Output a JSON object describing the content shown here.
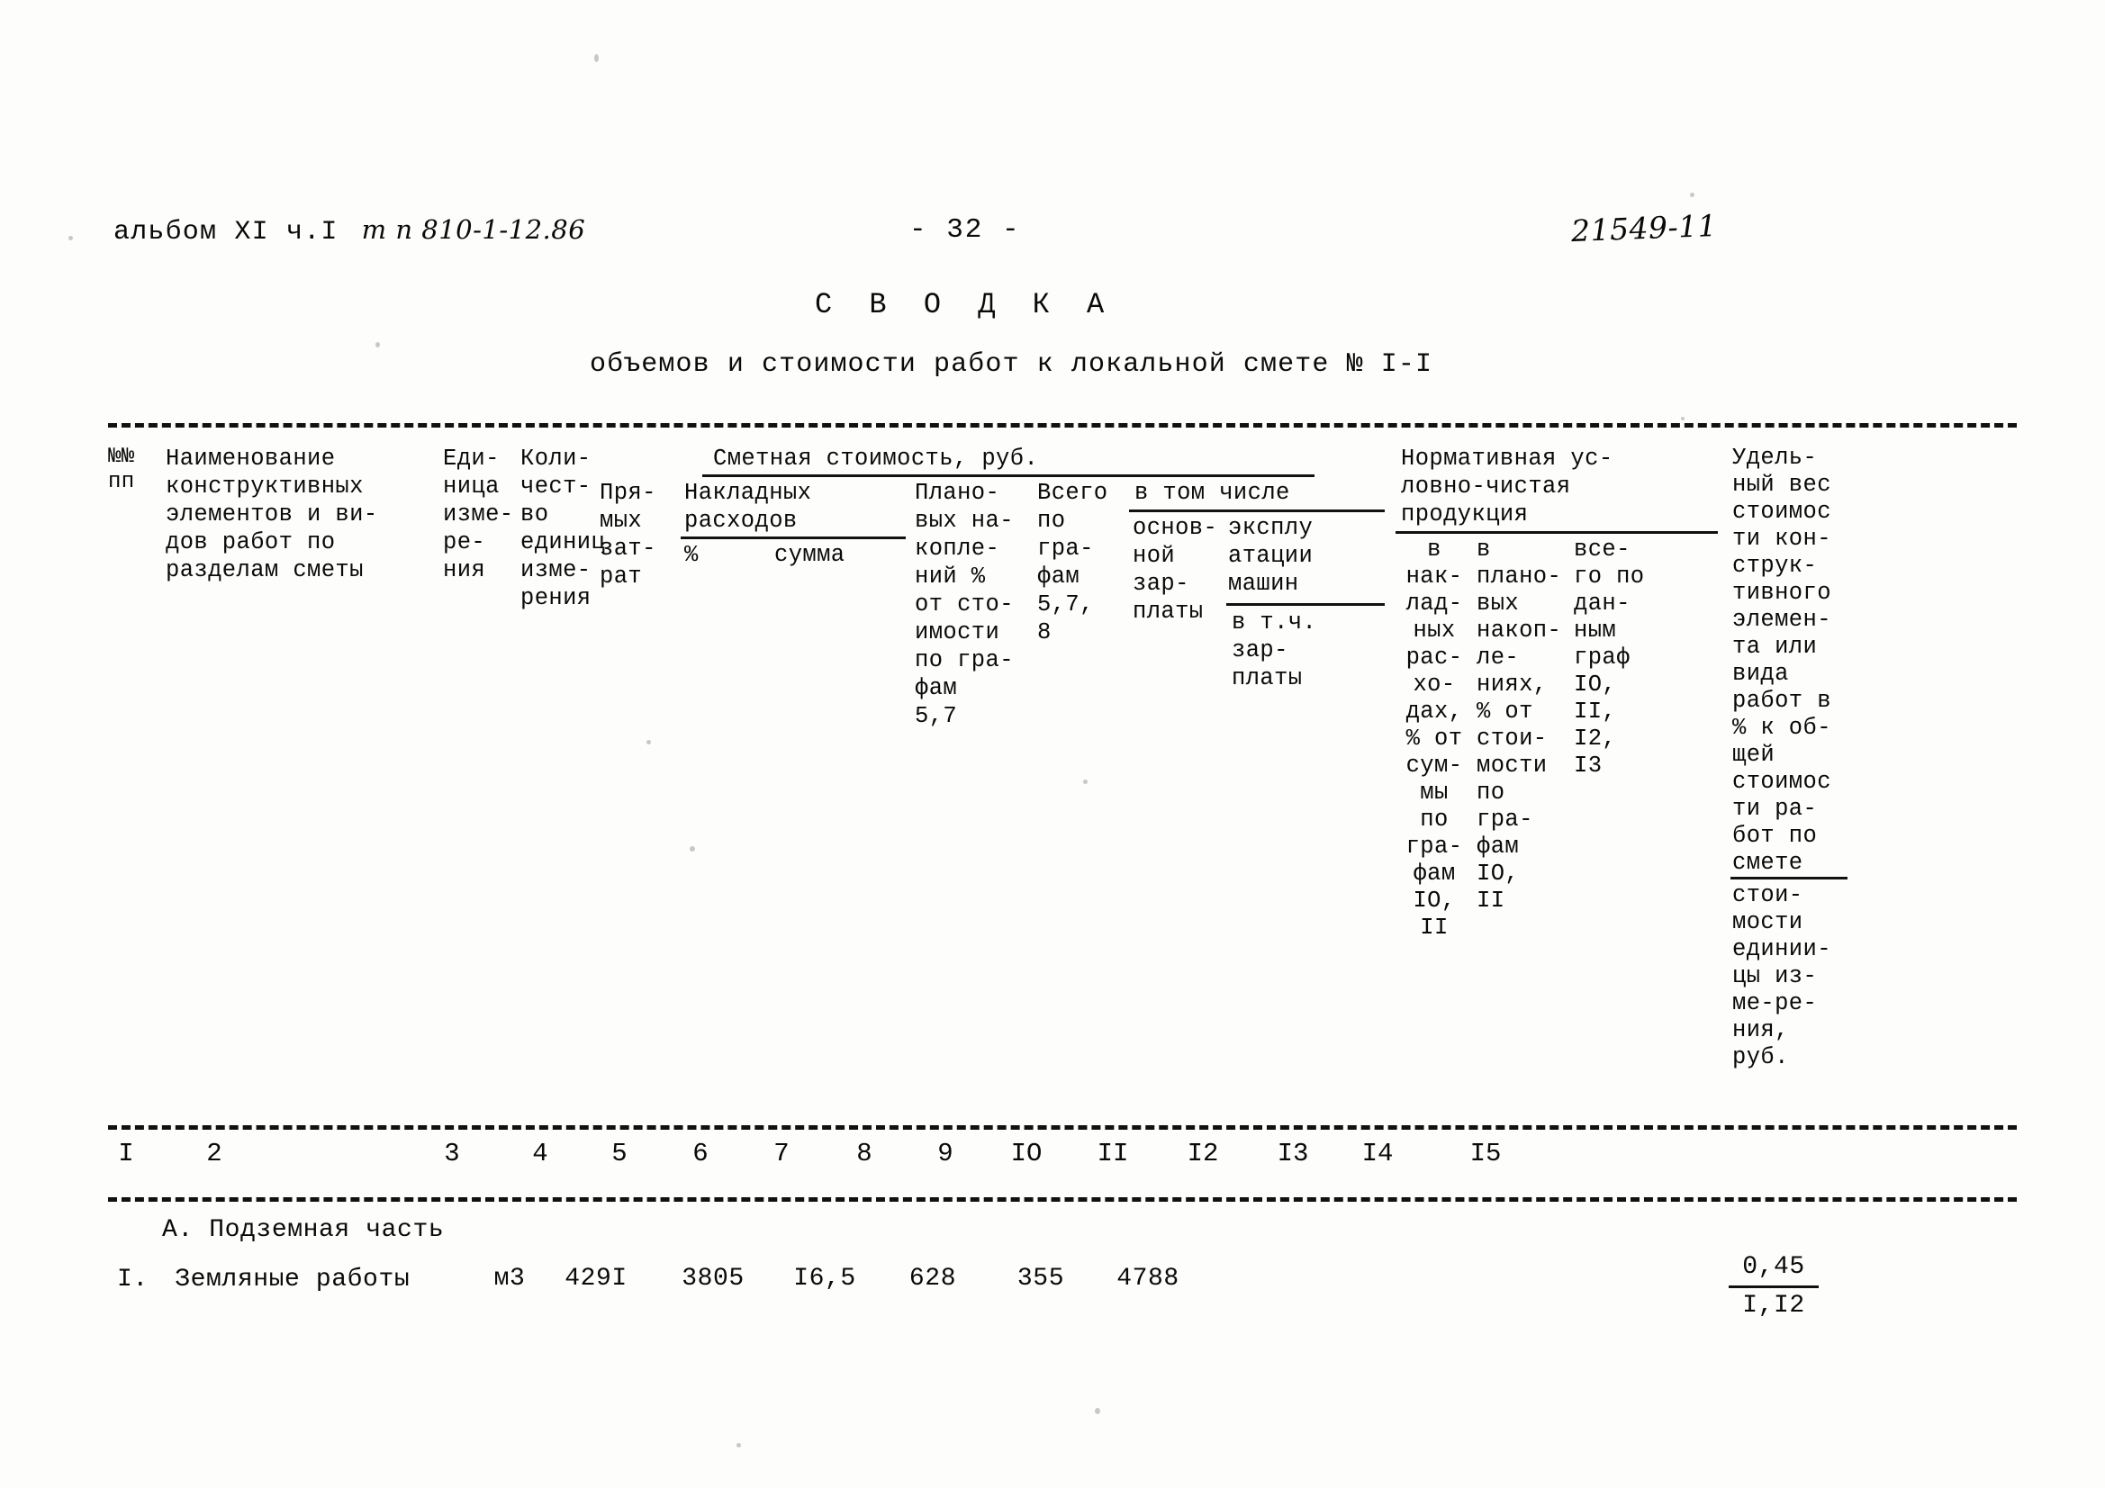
{
  "header": {
    "album": "альбом XI ч.I",
    "type_code": "т п 810-1-12.86",
    "page_number": "- 32 -",
    "doc_code": "21549-11"
  },
  "title": {
    "main": "С В О Д К А",
    "subtitle": "объемов и стоимости работ к локальной смете № I-I"
  },
  "table": {
    "group_headers": [
      {
        "label": "Сметная стоимость, руб."
      },
      {
        "label": "в том числе"
      },
      {
        "label": "Нормативная ус-\nловно-чистая\nпродукция"
      }
    ],
    "columns": [
      {
        "num": "I",
        "title": "№№\nпп"
      },
      {
        "num": "2",
        "title": "Наименование\nконструктивных\nэлементов и ви-\nдов работ по\nразделам сметы"
      },
      {
        "num": "3",
        "title": "Еди-\nница\nизме-\nре-\nния"
      },
      {
        "num": "4",
        "title": "Коли-\nчест-\nво\nединиц\nизме-\nрения"
      },
      {
        "num": "5",
        "title": "Пря-\nмых\nзат-\nрат"
      },
      {
        "num": "6",
        "title": "%"
      },
      {
        "num": "7",
        "title": "сумма"
      },
      {
        "num": "8",
        "title": "Плано-\nвых на-\nкопле-\nний %\nот сто-\nимости\nпо гра-\nфам\n5,7"
      },
      {
        "num": "9",
        "title": "Всего\nпо\nгра-\nфам\n5,7,\n8"
      },
      {
        "num": "IO",
        "title": "основ-\nной\nзар-\nплаты"
      },
      {
        "num": "II",
        "title": "эксплу\nатации\nмашин"
      },
      {
        "num": "I2",
        "title": "в\nнак-\nлад-\nных\nрас-\nхо-\nдах,\n% от\nсум-\nмы\nпо\nгра-\nфам\nIO,\nII"
      },
      {
        "num": "I3",
        "title": "в\nплано-\nвых\nнакоп-\nле-\nниях,\n% от\nстои-\nмости\nпо\nгра-\nфам\nIO,\nII"
      },
      {
        "num": "I4",
        "title": "все-\nго по\nдан-\nным\nграф\nIO,\nII,\nI2,\nI3"
      },
      {
        "num": "I5",
        "title": "Удель-\nный вес\nстоимос\nти кон-\nструк-\nтивного\nэлемен-\nта или\nвида\nработ в\n% к об-\nщей\nстоимос\nти ра-\nбот по\nсмете"
      }
    ],
    "sub_labels": {
      "nakladnyh": "Накладных\nрасходов",
      "v_tch_zarplaty": "в т.ч.\nзар-\nплаты",
      "col15_denominator": "стои-\nмости\nединии-\nцы из-\nме-ре-\nния,\nруб."
    },
    "rows": [
      {
        "type": "section",
        "label": "А. Подземная часть"
      },
      {
        "type": "data",
        "no": "I.",
        "name": "Земляные работы",
        "unit": "м3",
        "qty": "429I",
        "direct": "3805",
        "oh_pct": "I6,5",
        "oh_sum": "628",
        "plan_sav": "355",
        "total": "4788",
        "c10": "",
        "c11": "",
        "c12": "",
        "c13": "",
        "c14": "",
        "c15_num": "0,45",
        "c15_den": "I,I2"
      }
    ]
  }
}
